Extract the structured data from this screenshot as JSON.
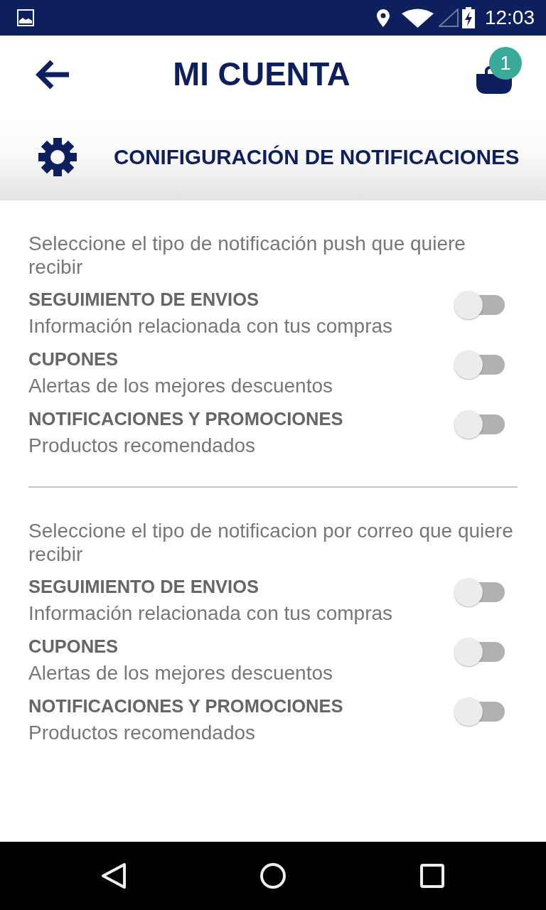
{
  "status_bar": {
    "time": "12:03"
  },
  "app_bar": {
    "title": "MI CUENTA",
    "cart_count": "1"
  },
  "header": {
    "title": "CONIFIGURACIÓN DE NOTIFICACIONES"
  },
  "sections": [
    {
      "intro": "Seleccione el tipo de notificación push que quiere recibir",
      "options": [
        {
          "title": "SEGUIMIENTO DE ENVIOS",
          "description": "Información relacionada con tus compras",
          "on": false
        },
        {
          "title": "CUPONES",
          "description": "Alertas de los mejores descuentos",
          "on": false
        },
        {
          "title": "NOTIFICACIONES Y PROMOCIONES",
          "description": "Productos recomendados",
          "on": false
        }
      ]
    },
    {
      "intro": "Seleccione el tipo de notificacion por correo que quiere recibir",
      "options": [
        {
          "title": "SEGUIMIENTO DE ENVIOS",
          "description": "Información relacionada con tus compras",
          "on": false
        },
        {
          "title": "CUPONES",
          "description": "Alertas de los mejores descuentos",
          "on": false
        },
        {
          "title": "NOTIFICACIONES Y PROMOCIONES",
          "description": "Productos recomendados",
          "on": false
        }
      ]
    }
  ]
}
